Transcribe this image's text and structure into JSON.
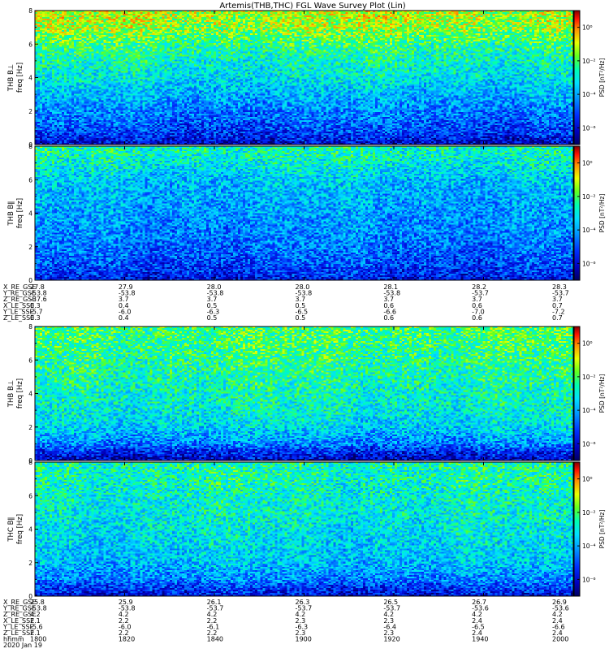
{
  "title": "Artemis(THB,THC) FGL Wave Survey Plot (Lin)",
  "colors": {
    "background": "#ffffff",
    "frame": "#000000",
    "colormap": [
      "#000080",
      "#0000ff",
      "#0080ff",
      "#00c8ff",
      "#00ffa0",
      "#80ff00",
      "#ffff00",
      "#ff8000",
      "#ff0000",
      "#800000"
    ]
  },
  "chart_data": [
    {
      "type": "heatmap",
      "panel": "THB B|_ spectrogram",
      "ylabel_probe": "THB B⊥",
      "ylabel": "freq [Hz]",
      "ylim": [
        0,
        8
      ],
      "yticks": [
        0,
        2,
        4,
        6,
        8
      ],
      "colorbar_label": "PSD [nT²/Hz]",
      "colorbar_ticks": [
        "10⁰",
        "10⁻²",
        "10⁻⁴",
        "10⁻⁶"
      ],
      "colorbar_ticks_data": [
        0,
        -2,
        -4,
        -6
      ],
      "colorbar_log_range": [
        -7,
        1
      ],
      "profile": {
        "freq": [
          0,
          0.5,
          1,
          2,
          3,
          4,
          5,
          6,
          6.5,
          7,
          8
        ],
        "log_psd": [
          -6.2,
          -5.4,
          -5.0,
          -4.4,
          -3.8,
          -3.2,
          -2.8,
          -2.3,
          -1.8,
          -1.4,
          -1.2
        ]
      },
      "grid": false
    },
    {
      "type": "heatmap",
      "panel": "THB B|| spectrogram",
      "ylabel_probe": "THB B∥",
      "ylabel": "freq [Hz]",
      "ylim": [
        0,
        8
      ],
      "yticks": [
        0,
        2,
        4,
        6,
        8
      ],
      "colorbar_label": "PSD [nT²/Hz]",
      "colorbar_ticks": [
        "10⁰",
        "10⁻²",
        "10⁻⁴",
        "10⁻⁶"
      ],
      "colorbar_ticks_data": [
        0,
        -2,
        -4,
        -6
      ],
      "colorbar_log_range": [
        -7,
        1
      ],
      "profile": {
        "freq": [
          0,
          0.5,
          1,
          2,
          3,
          4,
          5,
          6,
          7,
          8
        ],
        "log_psd": [
          -5.8,
          -5.3,
          -5.0,
          -4.6,
          -4.3,
          -4.1,
          -3.9,
          -3.6,
          -3.0,
          -2.6
        ]
      },
      "grid": false
    },
    {
      "type": "heatmap",
      "panel": "THC B|_ spectrogram",
      "ylabel_probe": "THB B⊥",
      "ylabel": "freq [Hz]",
      "ylim": [
        0,
        8
      ],
      "yticks": [
        0,
        2,
        4,
        6,
        8
      ],
      "colorbar_label": "PSD [nT²/Hz]",
      "colorbar_ticks": [
        "10⁰",
        "10⁻²",
        "10⁻⁴",
        "10⁻⁶"
      ],
      "colorbar_ticks_data": [
        0,
        -2,
        -4,
        -6
      ],
      "colorbar_log_range": [
        -7,
        1
      ],
      "profile": {
        "freq": [
          0,
          0.5,
          1,
          2,
          3,
          4,
          5,
          6,
          7,
          8
        ],
        "log_psd": [
          -6.2,
          -5.5,
          -4.4,
          -3.4,
          -3.0,
          -2.8,
          -2.6,
          -2.4,
          -2.2,
          -2.1
        ]
      },
      "grid": false
    },
    {
      "type": "heatmap",
      "panel": "THC B|| spectrogram",
      "ylabel_probe": "THC B∥",
      "ylabel": "freq [Hz]",
      "ylim": [
        0,
        8
      ],
      "yticks": [
        0,
        2,
        4,
        6,
        8
      ],
      "colorbar_label": "PSD [nT²/Hz]",
      "colorbar_ticks": [
        "10⁰",
        "10⁻²",
        "10⁻⁴",
        "10⁻⁶"
      ],
      "colorbar_ticks_data": [
        0,
        -2,
        -4,
        -6
      ],
      "colorbar_log_range": [
        -7,
        1
      ],
      "profile": {
        "freq": [
          0,
          0.5,
          1,
          2,
          3,
          4,
          5,
          6,
          7,
          8
        ],
        "log_psd": [
          -5.9,
          -5.2,
          -4.4,
          -3.7,
          -3.4,
          -3.2,
          -3.0,
          -2.9,
          -2.7,
          -2.6
        ]
      },
      "grid": false
    }
  ],
  "ephem_top": {
    "labels": [
      "X_RE_GSE",
      "Y_RE_GSE",
      "Z_RE_GSE",
      "X_LE_SSE",
      "Y_LE_SSE",
      "Z_LE_SSE"
    ],
    "columns": [
      [
        "27.8",
        "-53.8",
        "-37.6",
        "0.3",
        "-5.7",
        "0.3"
      ],
      [
        "27.9",
        "-53.8",
        "3.7",
        "0.4",
        "-6.0",
        "0.4"
      ],
      [
        "28.0",
        "-53.8",
        "3.7",
        "0.5",
        "-6.3",
        "0.5"
      ],
      [
        "28.0",
        "-53.8",
        "3.7",
        "0.5",
        "-6.5",
        "0.5"
      ],
      [
        "28.1",
        "-53.8",
        "3.7",
        "0.6",
        "-6.6",
        "0.6"
      ],
      [
        "28.2",
        "-53.7",
        "3.7",
        "0.6",
        "-7.0",
        "0.6"
      ],
      [
        "28.3",
        "-53.7",
        "3.7",
        "0.7",
        "-7.2",
        "0.7"
      ]
    ]
  },
  "ephem_bottom": {
    "labels": [
      "X_RE_GSE",
      "Y_RE_GSE",
      "Z_RE_GSE",
      "X_LE_SSE",
      "Y_LE_SSE",
      "Z_LE_SSE",
      "hhmm",
      "2020 Jan 19"
    ],
    "columns": [
      [
        "25.8",
        "-53.8",
        "4.2",
        "2.1",
        "-5.6",
        "2.1",
        "1800",
        ""
      ],
      [
        "25.9",
        "-53.8",
        "4.2",
        "2.2",
        "-6.0",
        "2.2",
        "1820",
        ""
      ],
      [
        "26.1",
        "-53.7",
        "4.2",
        "2.2",
        "-6.1",
        "2.2",
        "1840",
        ""
      ],
      [
        "26.3",
        "-53.7",
        "4.2",
        "2.3",
        "-6.3",
        "2.3",
        "1900",
        ""
      ],
      [
        "26.5",
        "-53.7",
        "4.2",
        "2.3",
        "-6.4",
        "2.3",
        "1920",
        ""
      ],
      [
        "26.7",
        "-53.6",
        "4.2",
        "2.4",
        "-6.5",
        "2.4",
        "1940",
        ""
      ],
      [
        "26.9",
        "-53.6",
        "4.2",
        "2.4",
        "-6.6",
        "2.4",
        "2000",
        ""
      ]
    ]
  }
}
